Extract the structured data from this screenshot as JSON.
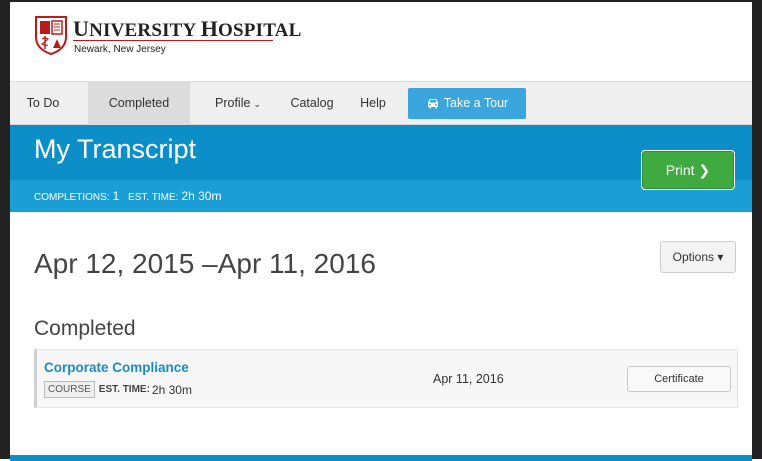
{
  "header": {
    "org_name_prefix_cap": "U",
    "org_name_rest": "NIVERSITY ",
    "org_name_cap2": "H",
    "org_name_rest2": "OSPITAL",
    "org_location": "Newark, New Jersey",
    "logo_icon": "university-hospital-crest-icon"
  },
  "nav": {
    "items": [
      {
        "label": "To Do"
      },
      {
        "label": "Completed"
      },
      {
        "label": "Profile"
      },
      {
        "label": "Catalog"
      },
      {
        "label": "Help"
      }
    ],
    "profile_chevron": "⌄",
    "tour_button": {
      "label": "Take a Tour",
      "icon": "car-icon"
    }
  },
  "banner": {
    "title": "My Transcript",
    "completions_label": "COMPLETIONS:",
    "completions_value": "1",
    "est_time_label": "EST. TIME:",
    "est_time_value": "2h 30m",
    "print_label": "Print",
    "print_arrow": "❯"
  },
  "content": {
    "date_range": "Apr 12, 2015 –Apr 11, 2016",
    "options_label": "Options ▾",
    "section_title": "Completed",
    "courses": [
      {
        "title": "Corporate Compliance",
        "type": "COURSE",
        "est_label": "EST. TIME:",
        "est_value": "2h 30m",
        "date": "Apr 11, 2016",
        "action": "Certificate"
      }
    ]
  },
  "colors": {
    "brand_blue": "#0c8ec8",
    "stats_blue": "#1b9ed6",
    "tour_blue": "#3aa6dd",
    "print_green": "#3faa3f",
    "link_blue": "#1b8bc4",
    "logo_red": "#b71c1c"
  }
}
